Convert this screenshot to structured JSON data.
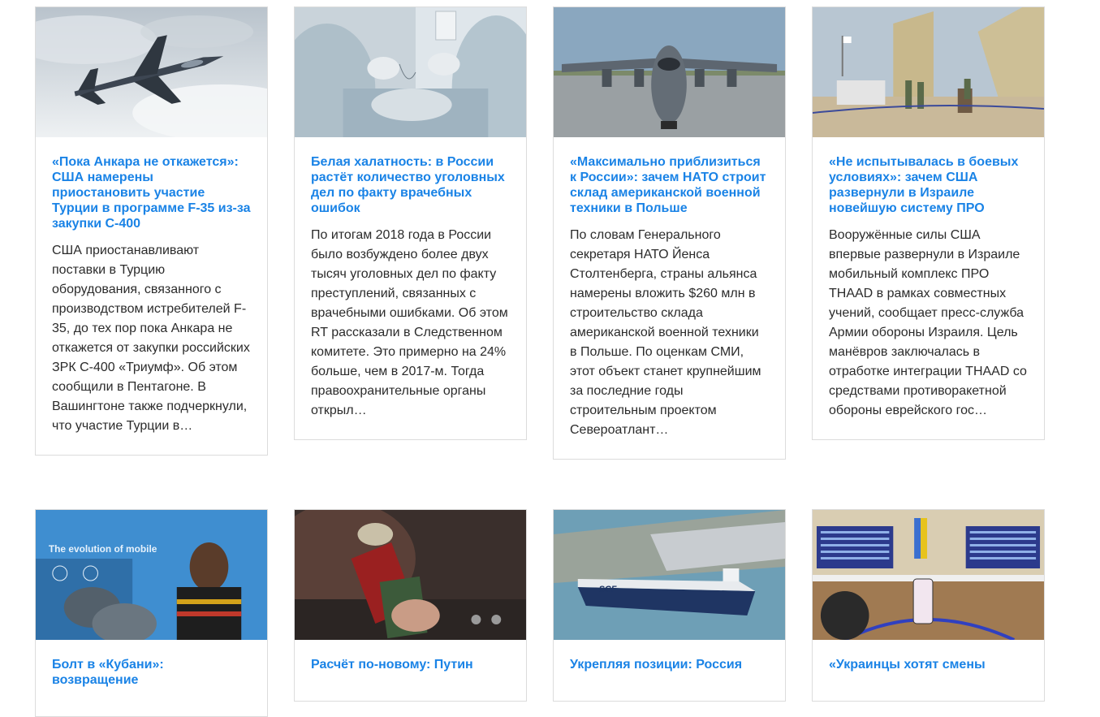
{
  "articles": [
    {
      "title": "«Пока Анкара не откажется»: США намерены приостановить участие Турции в программе F-35 из-за закупки С-400",
      "excerpt": "США приостанавливают поставки в Турцию оборудования, связанного с производством истребителей F-35, до тех пор пока Анкара не откажется от закупки российских ЗРК С-400 «Триумф». Об этом сообщили в Пентагоне. В Вашингтоне также подчеркнули, что участие Турции в…",
      "image": "f35-jet-image"
    },
    {
      "title": "Белая халатность: в России растёт количество уголовных дел по факту врачебных ошибок",
      "excerpt": "По итогам 2018 года в России было возбуждено более двух тысяч уголовных дел по факту преступлений, связанных с врачебными ошибками. Об этом RT рассказали в Следственном комитете. Это примерно на 24% больше, чем в 2017-м. Тогда правоохранительные органы открыл…",
      "image": "surgery-image"
    },
    {
      "title": "«Максимально приблизиться к России»: зачем НАТО строит склад американской военной техники в Польше",
      "excerpt": "По словам Генерального секретаря НАТО Йенса Столтенберга, страны альянса намерены вложить $260 млн в строительство склада американской военной техники в Польше. По оценкам СМИ, этот объект станет крупнейшим за последние годы строительным проектом Североатлант…",
      "image": "transport-plane-image"
    },
    {
      "title": "«Не испытывалась в боевых условиях»: зачем США развернули в Израиле новейшую систему ПРО",
      "excerpt": "Вооружённые силы США впервые развернули в Израиле мобильный комплекс ПРО THAAD в рамках совместных учений, сообщает пресс-служба Армии обороны Израиля. Цель манёвров заключалась в отработке интеграции THAAD со средствами противоракетной обороны еврейского гос…",
      "image": "thaad-system-image"
    },
    {
      "title": "Болт в «Кубани»: возвращение",
      "excerpt": "",
      "image": "athlete-press-image",
      "banner_text": "The evolution of mobile"
    },
    {
      "title": "Расчёт по-новому: Путин",
      "excerpt": "",
      "image": "passport-money-image"
    },
    {
      "title": "Укрепляя позиции: Россия",
      "excerpt": "",
      "image": "lng-tanker-image",
      "ship_label": "SCF"
    },
    {
      "title": "«Украинцы хотят смены",
      "excerpt": "",
      "image": "election-commission-image"
    }
  ]
}
